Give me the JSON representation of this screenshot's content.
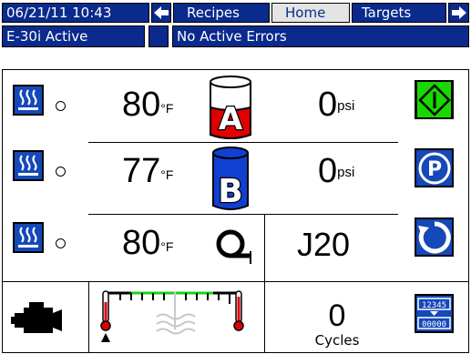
{
  "header": {
    "datetime": "06/21/11 10:43",
    "tabs": [
      {
        "label": "Recipes"
      },
      {
        "label": "Home"
      },
      {
        "label": "Targets"
      }
    ]
  },
  "status": {
    "mode": "E-30i Active",
    "errors": "No Active Errors"
  },
  "rows": {
    "a": {
      "temp": "80",
      "temp_unit": "°F",
      "tank_label": "A",
      "pressure": "0",
      "pressure_unit": "psi"
    },
    "b": {
      "temp": "77",
      "temp_unit": "°F",
      "tank_label": "B",
      "pressure": "0",
      "pressure_unit": "psi"
    },
    "hose": {
      "temp": "80",
      "temp_unit": "°F",
      "mix_chamber": "J20"
    }
  },
  "cycles": {
    "count": "0",
    "label": "Cycles"
  },
  "counter_icon": {
    "top": "12345",
    "bottom": "00000"
  },
  "colors": {
    "navy": "#0a2a8c",
    "button_blue": "#1548b8",
    "tank_a_red": "#e00000",
    "tank_b_blue": "#1040d0",
    "start_green": "#19d800"
  },
  "icons": [
    "left-arrow-icon",
    "right-arrow-icon",
    "heat-icon",
    "tank-a-icon",
    "tank-b-icon",
    "hose-icon",
    "start-icon",
    "park-icon",
    "reset-icon",
    "engine-icon",
    "thermometer-icon",
    "counter-reset-icon"
  ]
}
